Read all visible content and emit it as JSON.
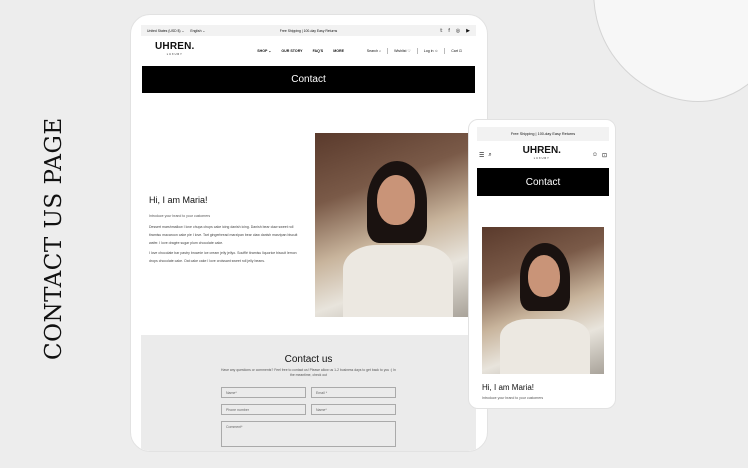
{
  "page": {
    "side_title": "CONTACT US PAGE"
  },
  "tablet": {
    "topbar": {
      "currency": "United States (USD $) ⌄",
      "language": "English ⌄",
      "promo": "Free Shipping | 100-day Easy Returns",
      "social_icons": [
        "twitter-icon",
        "facebook-icon",
        "pinterest-icon",
        "youtube-icon"
      ]
    },
    "header": {
      "logo": "UHREN.",
      "logo_sub": "LUXURY",
      "nav": [
        "SHOP ⌄",
        "OUR STORY",
        "FAQ'S",
        "MORE"
      ],
      "search": "Search",
      "wishlist": "Wishlist",
      "login": "Log in",
      "cart": "Cart"
    },
    "banner_title": "Contact",
    "intro": {
      "heading": "Hi, I am Maria!",
      "lead": "Introduce your brand to your customers",
      "p2": "Dessert marshmallow I love chupa chups cake icing danish icing. Danish bear claw sweet roll tiramisu macaroon cake pie I love. Tart gingerbread marzipan bear claw danish marzipan biscuit wafer. I love dragée sugar plum chocolate cake.",
      "p3": "I love chocolate bar pastry brownie ice cream jelly jellyo. Soufflé tiramisu liquorice biscuit lemon drops chocolate cake. Oat cake cake I love croissant sweet roll jelly beans."
    },
    "contact": {
      "heading": "Contact us",
      "text": "Have any questions or comments? Feel free to contact us! Please allow us 1-2 business days to get back to you :) In the meantime, check out",
      "name_placeholder": "Name*",
      "email_placeholder": "Email *",
      "phone_placeholder": "Phone number",
      "name2_placeholder": "Name*",
      "comment_placeholder": "Comment*"
    }
  },
  "phone": {
    "promo": "Free Shipping | 100-day Easy Returns",
    "logo": "UHREN.",
    "logo_sub": "LUXURY",
    "banner_title": "Contact",
    "heading": "Hi, I am Maria!",
    "lead": "Introduce your brand to your customers"
  }
}
